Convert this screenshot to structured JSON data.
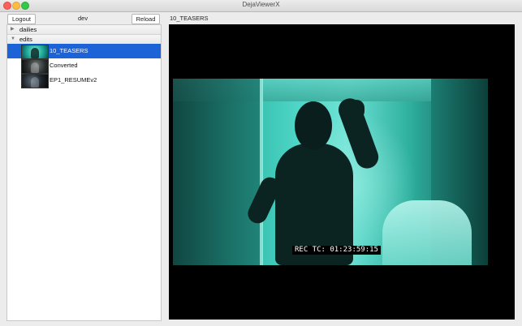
{
  "window": {
    "title": "DejaViewerX"
  },
  "toolbar": {
    "logout_label": "Logout",
    "env_label": "dev",
    "reload_label": "Reload"
  },
  "sidebar": {
    "groups": [
      {
        "label": "dailies",
        "expanded": false,
        "arrow_icon": "triangle-right-icon"
      },
      {
        "label": "edits",
        "expanded": true,
        "arrow_icon": "triangle-down-icon"
      }
    ],
    "items": [
      {
        "label": "10_TEASERS",
        "selected": true
      },
      {
        "label": "Converted",
        "selected": false
      },
      {
        "label": "EP1_RESUMEv2",
        "selected": false
      }
    ]
  },
  "viewer": {
    "media_title": "10_TEASERS",
    "timecode": "REC TC: 01:23:59:15"
  },
  "colors": {
    "selection": "#1d63d8",
    "viewer_background": "#000000"
  }
}
